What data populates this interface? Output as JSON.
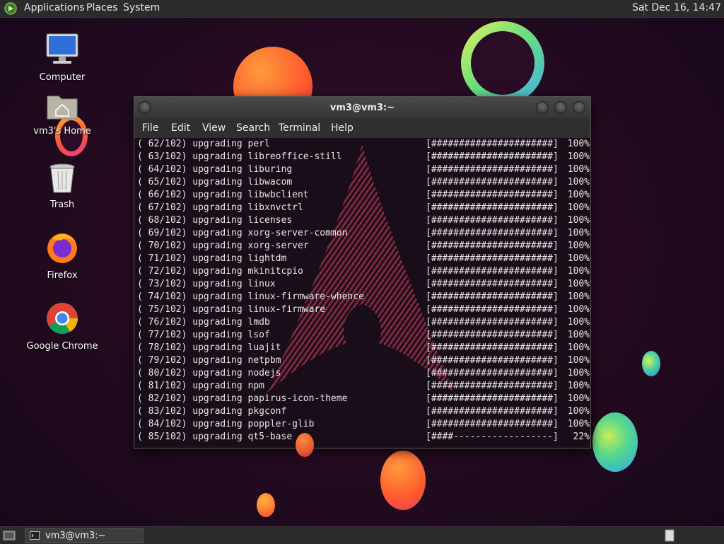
{
  "top_panel": {
    "menus": [
      "Applications",
      "Places",
      "System"
    ],
    "clock": "Sat Dec 16, 14:47"
  },
  "desktop_icons": [
    {
      "label": "Computer",
      "icon": "computer-icon"
    },
    {
      "label": "vm3's Home",
      "icon": "home-folder-icon"
    },
    {
      "label": "Trash",
      "icon": "trash-icon"
    },
    {
      "label": "Firefox",
      "icon": "firefox-icon"
    },
    {
      "label": "Google Chrome",
      "icon": "chrome-icon"
    }
  ],
  "terminal": {
    "title": "vm3@vm3:~",
    "menus": [
      "File",
      "Edit",
      "View",
      "Search",
      "Terminal",
      "Help"
    ],
    "lines": [
      {
        "text": "( 62/102) upgrading perl",
        "bar": "[######################]",
        "pct": "100%"
      },
      {
        "text": "( 63/102) upgrading libreoffice-still",
        "bar": "[######################]",
        "pct": "100%"
      },
      {
        "text": "( 64/102) upgrading liburing",
        "bar": "[######################]",
        "pct": "100%"
      },
      {
        "text": "( 65/102) upgrading libwacom",
        "bar": "[######################]",
        "pct": "100%"
      },
      {
        "text": "( 66/102) upgrading libwbclient",
        "bar": "[######################]",
        "pct": "100%"
      },
      {
        "text": "( 67/102) upgrading libxnvctrl",
        "bar": "[######################]",
        "pct": "100%"
      },
      {
        "text": "( 68/102) upgrading licenses",
        "bar": "[######################]",
        "pct": "100%"
      },
      {
        "text": "( 69/102) upgrading xorg-server-common",
        "bar": "[######################]",
        "pct": "100%"
      },
      {
        "text": "( 70/102) upgrading xorg-server",
        "bar": "[######################]",
        "pct": "100%"
      },
      {
        "text": "( 71/102) upgrading lightdm",
        "bar": "[######################]",
        "pct": "100%"
      },
      {
        "text": "( 72/102) upgrading mkinitcpio",
        "bar": "[######################]",
        "pct": "100%"
      },
      {
        "text": "( 73/102) upgrading linux",
        "bar": "[######################]",
        "pct": "100%"
      },
      {
        "text": "( 74/102) upgrading linux-firmware-whence",
        "bar": "[######################]",
        "pct": "100%"
      },
      {
        "text": "( 75/102) upgrading linux-firmware",
        "bar": "[######################]",
        "pct": "100%"
      },
      {
        "text": "( 76/102) upgrading lmdb",
        "bar": "[######################]",
        "pct": "100%"
      },
      {
        "text": "( 77/102) upgrading lsof",
        "bar": "[######################]",
        "pct": "100%"
      },
      {
        "text": "( 78/102) upgrading luajit",
        "bar": "[######################]",
        "pct": "100%"
      },
      {
        "text": "( 79/102) upgrading netpbm",
        "bar": "[######################]",
        "pct": "100%"
      },
      {
        "text": "( 80/102) upgrading nodejs",
        "bar": "[######################]",
        "pct": "100%"
      },
      {
        "text": "( 81/102) upgrading npm",
        "bar": "[######################]",
        "pct": "100%"
      },
      {
        "text": "( 82/102) upgrading papirus-icon-theme",
        "bar": "[######################]",
        "pct": "100%"
      },
      {
        "text": "( 83/102) upgrading pkgconf",
        "bar": "[######################]",
        "pct": "100%"
      },
      {
        "text": "( 84/102) upgrading poppler-glib",
        "bar": "[######################]",
        "pct": "100%"
      },
      {
        "text": "( 85/102) upgrading qt5-base",
        "bar": "[####------------------]",
        "pct": "22%"
      }
    ]
  },
  "taskbar": {
    "task_label": "vm3@vm3:~"
  },
  "colors": {
    "panel": "#2b2b2b",
    "terminal_bg": "#1a0d1a",
    "arch_pink": "#d0306a",
    "arch_yellow": "#e0b020"
  }
}
